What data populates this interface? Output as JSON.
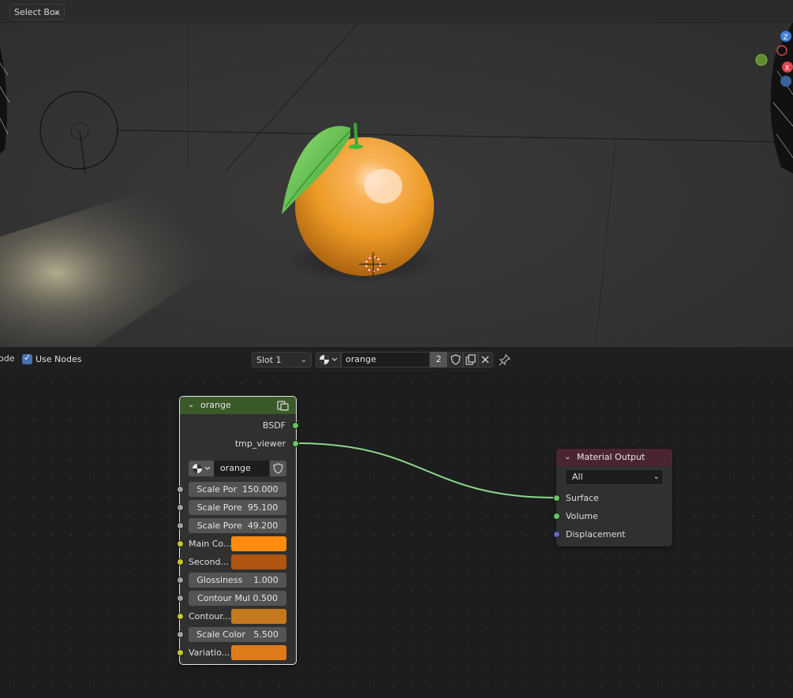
{
  "viewport": {
    "select_mode": "Select Box",
    "gizmo_axes": [
      "Z",
      "X"
    ]
  },
  "node_editor_header": {
    "mode_fragment": "ode",
    "use_nodes_label": "Use Nodes",
    "use_nodes_checked": true,
    "slot": "Slot 1",
    "material_name": "orange",
    "user_count": "2"
  },
  "group_node": {
    "title": "orange",
    "outputs": [
      "BSDF",
      "tmp_viewer"
    ],
    "datablock_name": "orange",
    "inputs": [
      {
        "label": "Scale Por",
        "value": "150.000",
        "kind": "value"
      },
      {
        "label": "Scale Pore",
        "value": "95.100",
        "kind": "value"
      },
      {
        "label": "Scale Pore",
        "value": "49.200",
        "kind": "value"
      },
      {
        "label": "Main Co...",
        "kind": "color",
        "color": "#ff8c0e"
      },
      {
        "label": "Second...",
        "kind": "color",
        "color": "#b05412"
      },
      {
        "label": "Glossiness",
        "value": "1.000",
        "kind": "value"
      },
      {
        "label": "Contour Mul",
        "value": "0.500",
        "kind": "value"
      },
      {
        "label": "Contour...",
        "kind": "color",
        "color": "#c4791c"
      },
      {
        "label": "Scale Color",
        "value": "5.500",
        "kind": "value"
      },
      {
        "label": "Variatio...",
        "kind": "color",
        "color": "#df7a1a"
      }
    ]
  },
  "output_node": {
    "title": "Material Output",
    "target": "All",
    "inputs": [
      "Surface",
      "Volume",
      "Displacement"
    ]
  },
  "colors": {
    "group_header": "#3b5a2a",
    "output_header": "#4a2530",
    "shader_socket": "#63c763",
    "value_socket": "#a1a1a1",
    "color_socket": "#c7c729",
    "vector_socket": "#6363c7",
    "accent_blue": "#4772b3"
  }
}
